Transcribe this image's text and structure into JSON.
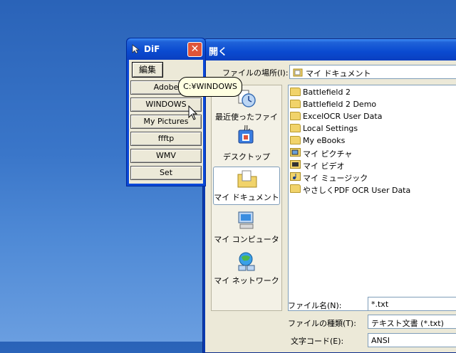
{
  "open_dialog": {
    "title": "開く",
    "look_in_label": "ファイルの場所(I):",
    "look_in_value": "マイ ドキュメント",
    "places": [
      {
        "label": "最近使ったファイル",
        "icon": "recent-files-icon"
      },
      {
        "label": "デスクトップ",
        "icon": "desktop-icon"
      },
      {
        "label": "マイ ドキュメント",
        "icon": "my-documents-icon"
      },
      {
        "label": "マイ コンピュータ",
        "icon": "my-computer-icon"
      },
      {
        "label": "マイ ネットワーク",
        "icon": "my-network-icon"
      }
    ],
    "files": [
      {
        "name": "Battlefield 2",
        "icon": "folder-icon"
      },
      {
        "name": "Battlefield 2 Demo",
        "icon": "folder-icon"
      },
      {
        "name": "ExcelOCR User Data",
        "icon": "folder-icon"
      },
      {
        "name": "Local Settings",
        "icon": "folder-icon"
      },
      {
        "name": "My eBooks",
        "icon": "folder-icon"
      },
      {
        "name": "マイ ピクチャ",
        "icon": "pictures-folder-icon"
      },
      {
        "name": "マイ ビデオ",
        "icon": "video-folder-icon"
      },
      {
        "name": "マイ ミュージック",
        "icon": "music-folder-icon"
      },
      {
        "name": "やさしくPDF OCR User Data",
        "icon": "folder-icon"
      }
    ],
    "filename_label": "ファイル名(N):",
    "filename_value": "*.txt",
    "filetype_label": "ファイルの種類(T):",
    "filetype_value": "テキスト文書 (*.txt)",
    "encoding_label": "文字コード(E):",
    "encoding_value": "ANSI"
  },
  "dif": {
    "title": "DiF",
    "close_label": "✕",
    "edit_label": "編集",
    "buttons": [
      "Adobe",
      "WINDOWS",
      "My Pictures",
      "ffftp",
      "WMV",
      "Set"
    ]
  },
  "tooltip": {
    "text": "C:¥WINDOWS"
  },
  "colors": {
    "title_blue": "#0a4ad0",
    "dialog_face": "#ece9d8",
    "close_red": "#e0553a",
    "tooltip_bg": "#ffffe1"
  }
}
